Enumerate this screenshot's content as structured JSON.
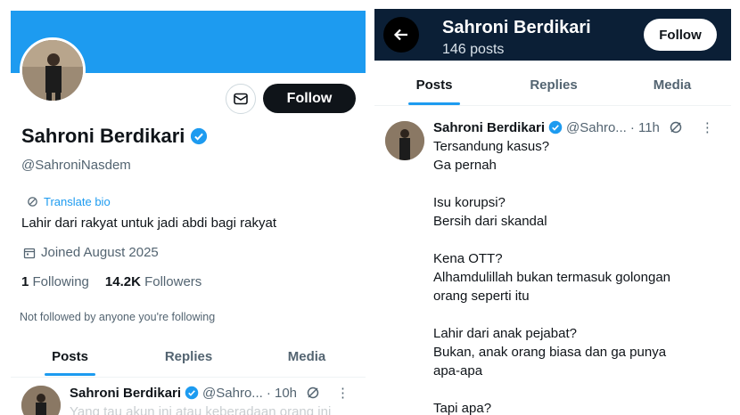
{
  "left": {
    "follow_label": "Follow",
    "name": "Sahroni Berdikari",
    "handle": "@SahroniNasdem",
    "translate_label": "Translate bio",
    "bio": "Lahir dari rakyat untuk jadi abdi bagi rakyat",
    "joined": "Joined August 2025",
    "following_count": "1",
    "following_label": "Following",
    "followers_count": "14.2K",
    "followers_label": "Followers",
    "not_followed": "Not followed by anyone you're following",
    "tabs": [
      {
        "label": "Posts"
      },
      {
        "label": "Replies"
      },
      {
        "label": "Media"
      }
    ],
    "tweet": {
      "name": "Sahroni Berdikari",
      "handle": "@Sahro...",
      "time": "· 10h",
      "preview": "Yang tau akun ini atau keberadaan orang ini"
    }
  },
  "right": {
    "header_name": "Sahroni Berdikari",
    "header_posts": "146 posts",
    "follow_label": "Follow",
    "tabs": [
      {
        "label": "Posts"
      },
      {
        "label": "Replies"
      },
      {
        "label": "Media"
      }
    ],
    "tweet": {
      "name": "Sahroni Berdikari",
      "handle": "@Sahro...",
      "time": "· 11h",
      "lines": [
        "Tersandung kasus?",
        "Ga pernah",
        "",
        "Isu korupsi?",
        "Bersih dari skandal",
        "",
        "Kena OTT?",
        "Alhamdulillah bukan termasuk golongan",
        "orang seperti itu",
        "",
        "Lahir dari anak pejabat?",
        "Bukan, anak orang biasa dan ga punya",
        "apa-apa",
        "",
        "Tapi apa?"
      ]
    }
  },
  "colors": {
    "accent": "#1d9bf0",
    "header_bg": "#0b1f36",
    "text": "#0f1419",
    "muted": "#536471"
  },
  "icons": [
    "mail-icon",
    "verified-badge-icon",
    "translate-icon",
    "calendar-icon",
    "back-arrow-icon",
    "grok-icon",
    "more-icon"
  ]
}
